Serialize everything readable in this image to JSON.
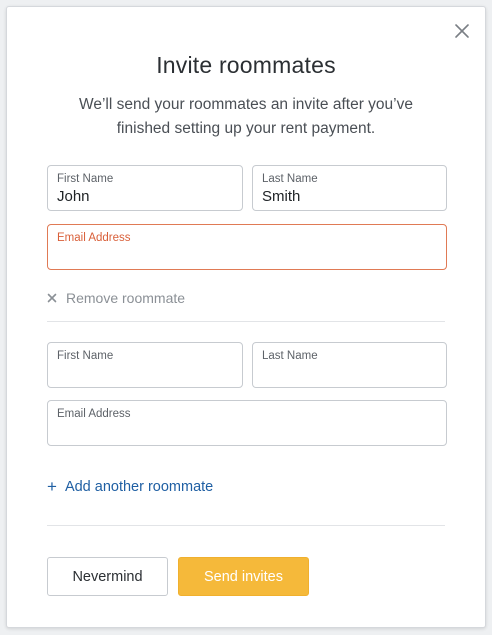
{
  "modal": {
    "title": "Invite roommates",
    "subtitle": "We’ll send your roommates an invite after you’ve finished setting up your rent payment."
  },
  "roommate1": {
    "first_name_label": "First Name",
    "first_name_value": "John",
    "last_name_label": "Last Name",
    "last_name_value": "Smith",
    "email_label": "Email Address",
    "email_value": "",
    "remove_label": "Remove roommate"
  },
  "roommate2": {
    "first_name_label": "First Name",
    "first_name_value": "",
    "last_name_label": "Last Name",
    "last_name_value": "",
    "email_label": "Email Address",
    "email_value": ""
  },
  "add_label": "Add another roommate",
  "buttons": {
    "cancel": "Nevermind",
    "submit": "Send invites"
  },
  "icons": {
    "close": "close-icon",
    "remove": "close-icon",
    "add": "plus-icon"
  },
  "colors": {
    "accent": "#f5b93a",
    "link": "#1f5fa3",
    "error": "#d9603a"
  }
}
